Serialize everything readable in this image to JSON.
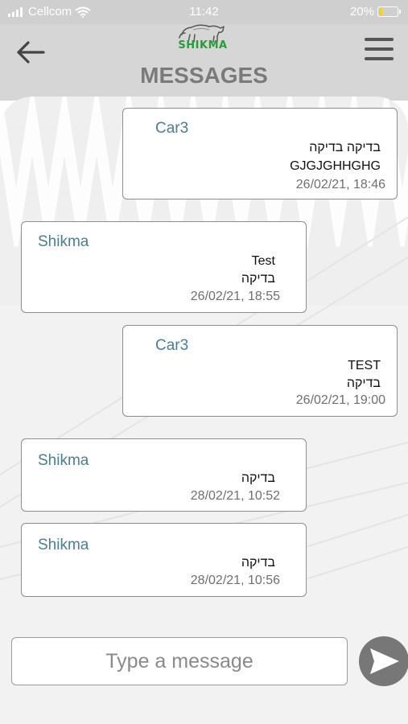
{
  "status_bar": {
    "carrier": "Cellcom",
    "time": "11:42",
    "battery": "20%",
    "battery_level": 0.2
  },
  "header": {
    "logo_text": "SHIKMA",
    "title": "MESSAGES",
    "back_icon": "arrow-left-icon",
    "menu_icon": "hamburger-menu-icon"
  },
  "messages": [
    {
      "sender": "Car3",
      "lines": [
        "בדיקה בדיקה",
        "GJGJGHHGHG"
      ],
      "timestamp": "26/02/21, 18:46",
      "side": "right"
    },
    {
      "sender": "Shikma",
      "lines": [
        "Test",
        "בדיקה"
      ],
      "timestamp": "26/02/21, 18:55",
      "side": "left"
    },
    {
      "sender": "Car3",
      "lines": [
        "TEST",
        "בדיקה"
      ],
      "timestamp": "26/02/21, 19:00",
      "side": "right"
    },
    {
      "sender": "Shikma",
      "lines": [
        "בדיקה"
      ],
      "timestamp": "28/02/21, 10:52",
      "side": "left"
    },
    {
      "sender": "Shikma",
      "lines": [
        "בדיקה"
      ],
      "timestamp": "28/02/21, 10:56",
      "side": "left"
    }
  ],
  "composer": {
    "placeholder": "Type a message",
    "value": "",
    "send_icon": "send-arrow-icon"
  },
  "colors": {
    "sender": "#4b7d94",
    "logo": "#2a9a3c",
    "title": "#7a7a7a",
    "header_bg": "#d6d6d6",
    "send_button": "#777777"
  }
}
